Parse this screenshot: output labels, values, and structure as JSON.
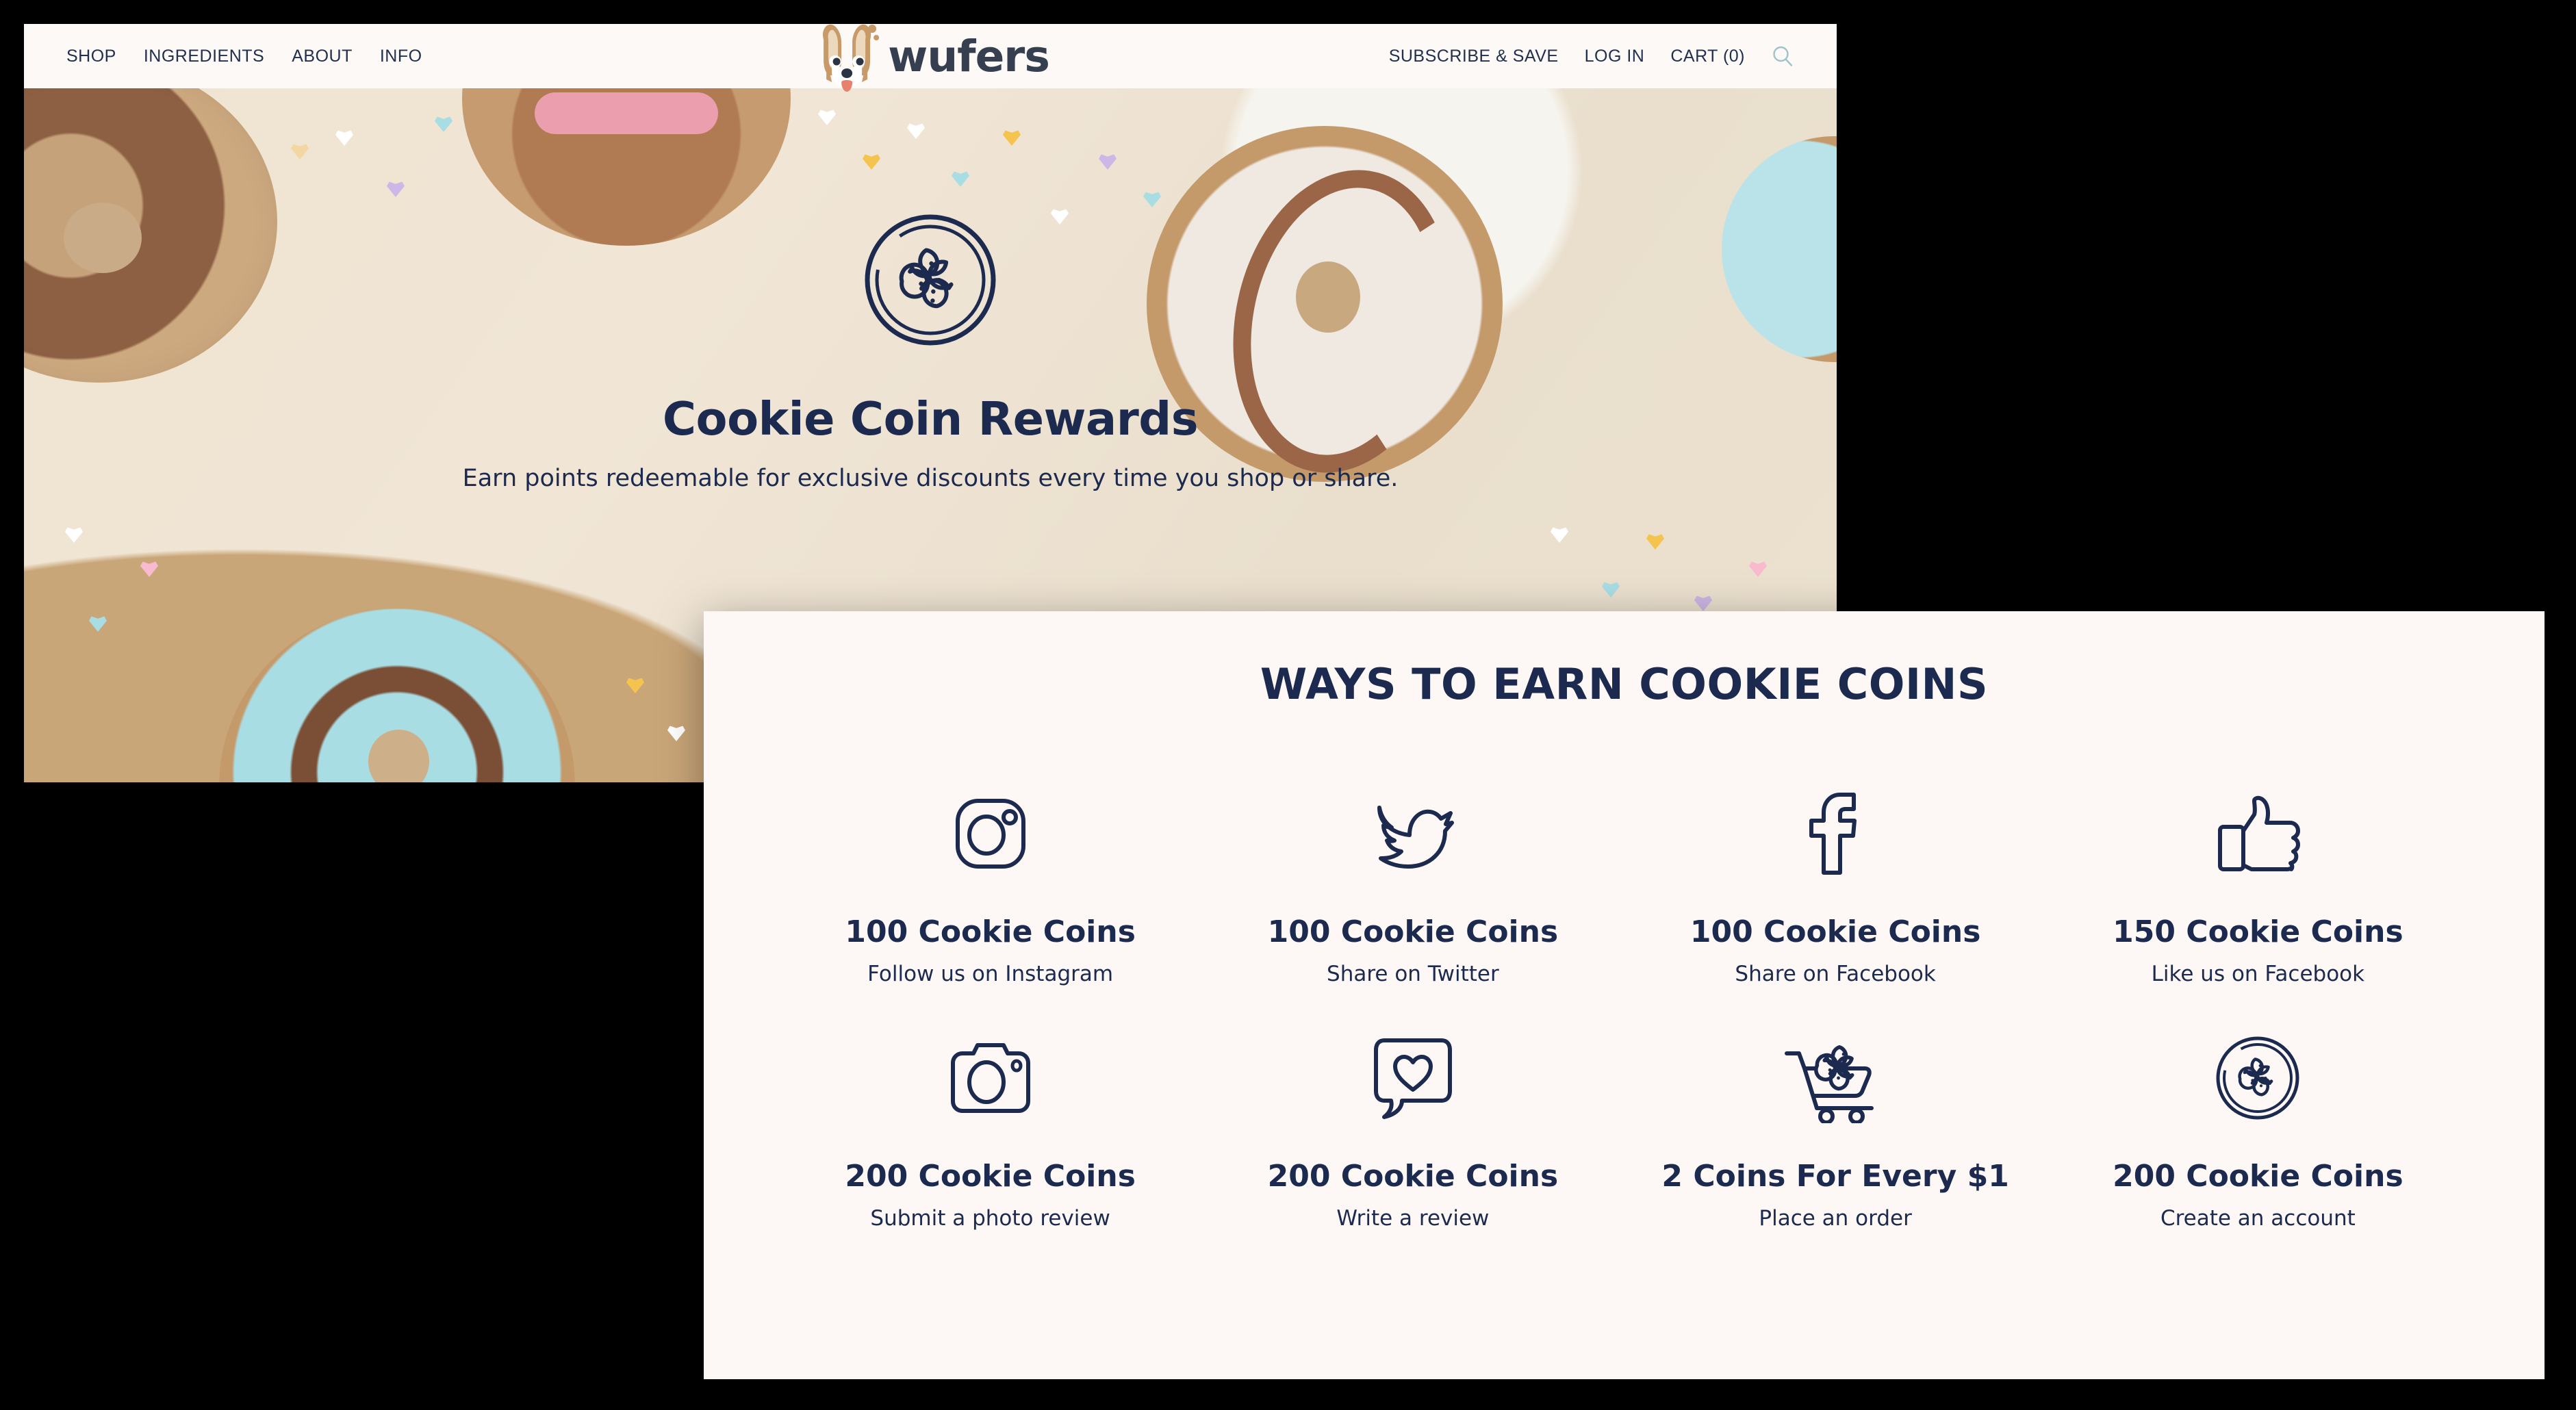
{
  "site": {
    "logo_word": "wufers",
    "logo_icon": "corgi-dog-face-logo"
  },
  "nav": {
    "left_items": [
      {
        "label": "SHOP",
        "name": "nav-link-shop"
      },
      {
        "label": "INGREDIENTS",
        "name": "nav-link-ingredients"
      },
      {
        "label": "ABOUT",
        "name": "nav-link-about"
      },
      {
        "label": "INFO",
        "name": "nav-link-info"
      }
    ],
    "right_items": [
      {
        "label": "SUBSCRIBE & SAVE",
        "name": "nav-link-subscribe-and-save"
      },
      {
        "label": "LOG IN",
        "name": "nav-link-log-in"
      },
      {
        "label": "CART (0)",
        "name": "nav-link-cart"
      }
    ],
    "search_icon": "search-icon"
  },
  "hero": {
    "icon": "dog-bone-in-circle-icon",
    "title": "Cookie Coin Rewards",
    "subtitle": "Earn points redeemable for exclusive discounts every time you shop or share."
  },
  "earn_panel": {
    "title": "WAYS TO EARN COOKIE COINS",
    "items": [
      {
        "icon": "instagram-icon",
        "amount": "100 Cookie Coins",
        "desc": "Follow us on Instagram"
      },
      {
        "icon": "twitter-bird-icon",
        "amount": "100 Cookie Coins",
        "desc": "Share on Twitter"
      },
      {
        "icon": "facebook-f-icon",
        "amount": "100 Cookie Coins",
        "desc": "Share on Facebook"
      },
      {
        "icon": "thumbs-up-icon",
        "amount": "150 Cookie Coins",
        "desc": "Like us on Facebook"
      },
      {
        "icon": "camera-icon",
        "amount": "200 Cookie Coins",
        "desc": "Submit a photo review"
      },
      {
        "icon": "speech-bubble-heart-icon",
        "amount": "200 Cookie Coins",
        "desc": "Write a review"
      },
      {
        "icon": "shopping-cart-with-bone-icon",
        "amount": "2 Coins For Every $1",
        "desc": "Place an order"
      },
      {
        "icon": "dog-bone-in-circle-icon",
        "amount": "200 Cookie Coins",
        "desc": "Create an account"
      }
    ]
  },
  "colors": {
    "navy": "#1b2a4e",
    "cream": "#fdf9f6",
    "panel": "#fdf8f5",
    "search_icon": "#9dc3cc",
    "logo_tan": "#c89a68",
    "backdrop": "#000000"
  }
}
